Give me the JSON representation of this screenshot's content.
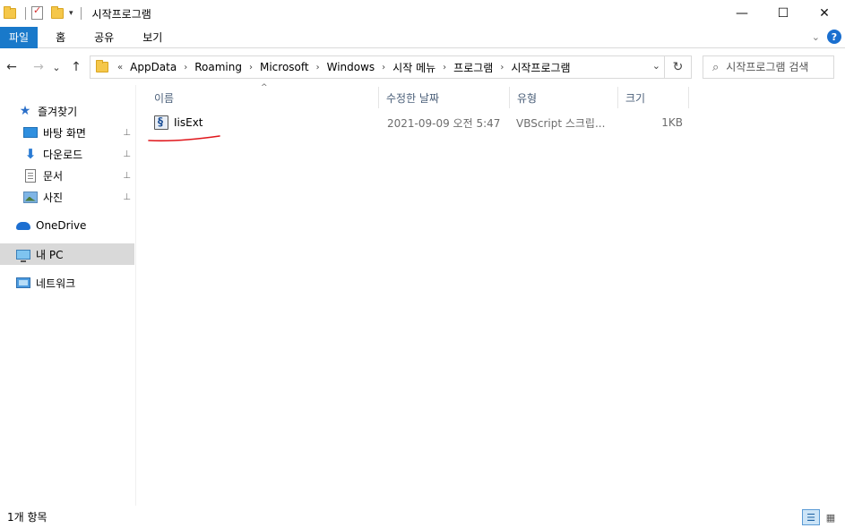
{
  "window": {
    "title": "시작프로그램",
    "controls": {
      "minimize": "—",
      "maximize": "☐",
      "close": "✕"
    }
  },
  "ribbon": {
    "tabs": [
      {
        "label": "파일"
      },
      {
        "label": "홈"
      },
      {
        "label": "공유"
      },
      {
        "label": "보기"
      }
    ],
    "collapse_icon": "chevron-down-icon",
    "help_label": "?"
  },
  "nav": {
    "back": "←",
    "forward": "→",
    "recent": "⌄",
    "up": "↑"
  },
  "address": {
    "overflow": "«",
    "crumbs": [
      "AppData",
      "Roaming",
      "Microsoft",
      "Windows",
      "시작 메뉴",
      "프로그램",
      "시작프로그램"
    ],
    "separator": "›",
    "refresh": "↻",
    "dropdown": "⌄"
  },
  "search": {
    "placeholder": "시작프로그램 검색",
    "icon": "⌕"
  },
  "sidebar": {
    "quick_access": {
      "label": "즐겨찾기",
      "icon": "star-icon"
    },
    "items": [
      {
        "label": "바탕 화면",
        "icon": "desktop-icon",
        "pinned": true
      },
      {
        "label": "다운로드",
        "icon": "download-icon",
        "pinned": true
      },
      {
        "label": "문서",
        "icon": "document-icon",
        "pinned": true
      },
      {
        "label": "사진",
        "icon": "pictures-icon",
        "pinned": true
      }
    ],
    "onedrive": {
      "label": "OneDrive",
      "icon": "cloud-icon"
    },
    "this_pc": {
      "label": "내 PC",
      "icon": "computer-icon",
      "selected": true
    },
    "network": {
      "label": "네트워크",
      "icon": "network-icon"
    },
    "pin_glyph": "📌"
  },
  "file_list": {
    "columns": [
      "이름",
      "수정한 날짜",
      "유형",
      "크기"
    ],
    "sort_indicator": "^",
    "rows": [
      {
        "name": "IisExt",
        "modified": "2021-09-09 오전 5:47",
        "type": "VBScript 스크립...",
        "size": "1KB",
        "icon": "vbscript-file-icon"
      }
    ]
  },
  "status": {
    "item_count": "1개 항목"
  },
  "colors": {
    "file_tab": "#1979ca",
    "selected_nav": "#d9d9d9",
    "annotation_line": "#e0161b",
    "column_header_text": "#4c607a"
  }
}
